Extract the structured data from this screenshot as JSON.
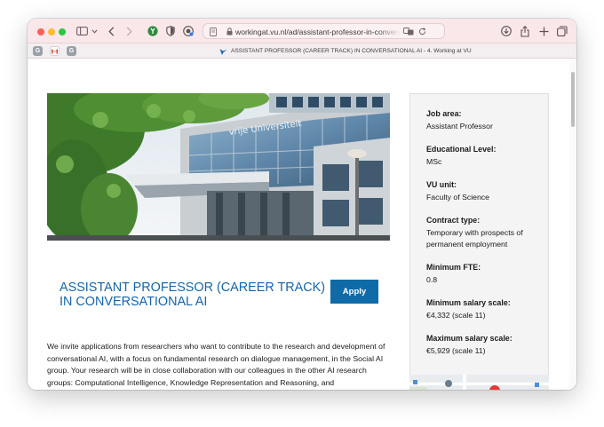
{
  "browser": {
    "url": "workingat.vu.nl/ad/assistant-professor-in-conversational-ai",
    "tab_title": "ASSISTANT PROFESSOR (CAREER TRACK) IN CONVERSATIONAL AI - 4. Working at VU",
    "pinned_tabs": [
      {
        "label": "G",
        "color": "#9aa0a6"
      },
      {
        "label": "",
        "color": "#ffffff"
      },
      {
        "label": "G",
        "color": "#9aa0a6"
      }
    ]
  },
  "hero": {
    "building_sign": "vrije Universiteit"
  },
  "job": {
    "title": "ASSISTANT PROFESSOR (CAREER TRACK) IN CONVERSATIONAL AI",
    "apply_label": "Apply",
    "intro": "We invite applications from researchers who want to contribute to the research and development of conversational AI, with a focus on fundamental research on dialogue management, in the Social AI group. Your research will be in close collaboration with our colleagues in the other AI research groups: Computational Intelligence, Knowledge Representation and Reasoning, and"
  },
  "details": [
    {
      "label": "Job area:",
      "value": "Assistant Professor"
    },
    {
      "label": "Educational Level:",
      "value": "MSc"
    },
    {
      "label": "VU unit:",
      "value": "Faculty of Science"
    },
    {
      "label": "Contract type:",
      "value": "Temporary with prospects of permanent employment"
    },
    {
      "label": "Minimum FTE:",
      "value": "0.8"
    },
    {
      "label": "Minimum salary scale:",
      "value": "€4,332 (scale 11)"
    },
    {
      "label": "Maximum salary scale:",
      "value": "€5,929 (scale 11)"
    }
  ],
  "colors": {
    "accent": "#1565a8",
    "button": "#0f6aa8",
    "toolbar": "#f9e7ea"
  }
}
